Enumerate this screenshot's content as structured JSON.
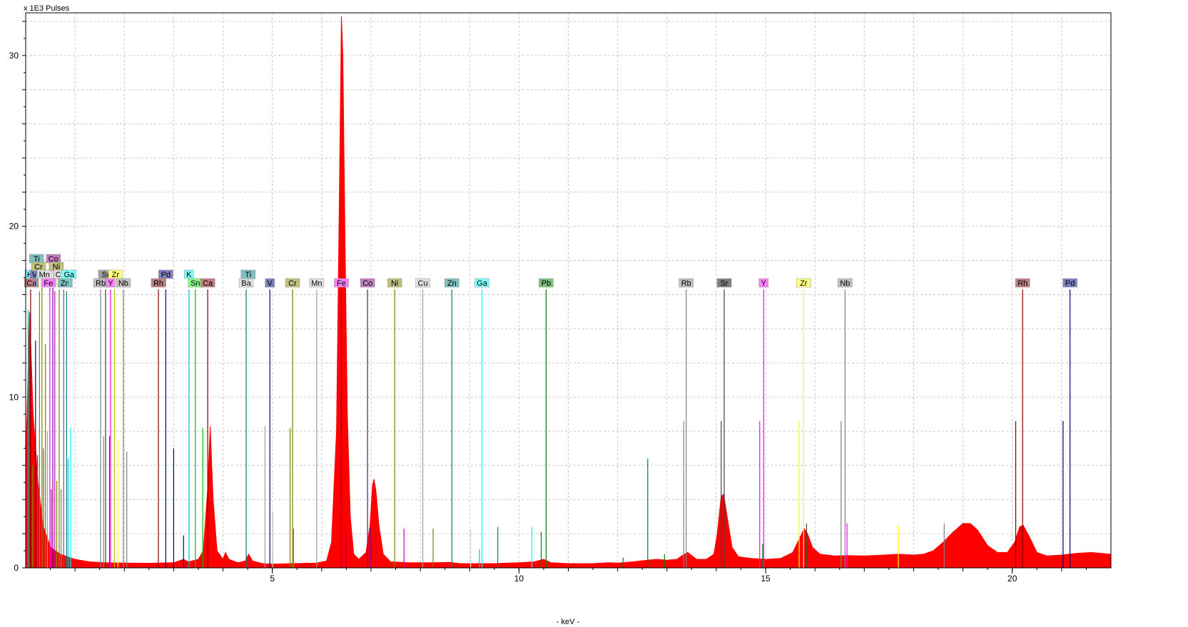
{
  "chart_data": {
    "type": "area",
    "ylabel": "x 1E3 Pulses",
    "xlabel": "- keV -",
    "xlim": [
      0.0,
      22.0
    ],
    "ylim": [
      0,
      32.5
    ],
    "grid": true,
    "x_ticks": [
      5,
      10,
      15,
      20
    ],
    "y_ticks": [
      10,
      20,
      30
    ],
    "spectrum": {
      "color": "#ff0000",
      "points": [
        [
          0.0,
          6.0
        ],
        [
          0.08,
          15.0
        ],
        [
          0.15,
          9.0
        ],
        [
          0.25,
          5.0
        ],
        [
          0.35,
          2.5
        ],
        [
          0.5,
          1.2
        ],
        [
          0.7,
          0.8
        ],
        [
          1.0,
          0.5
        ],
        [
          1.3,
          0.35
        ],
        [
          1.6,
          0.3
        ],
        [
          2.0,
          0.28
        ],
        [
          2.5,
          0.27
        ],
        [
          3.0,
          0.3
        ],
        [
          3.2,
          0.5
        ],
        [
          3.3,
          0.35
        ],
        [
          3.5,
          0.5
        ],
        [
          3.6,
          1.0
        ],
        [
          3.69,
          4.6
        ],
        [
          3.74,
          8.3
        ],
        [
          3.8,
          4.0
        ],
        [
          3.88,
          1.0
        ],
        [
          4.0,
          0.5
        ],
        [
          4.05,
          0.9
        ],
        [
          4.12,
          0.5
        ],
        [
          4.3,
          0.3
        ],
        [
          4.45,
          0.4
        ],
        [
          4.52,
          0.8
        ],
        [
          4.6,
          0.4
        ],
        [
          4.8,
          0.25
        ],
        [
          5.0,
          0.22
        ],
        [
          5.4,
          0.25
        ],
        [
          5.9,
          0.28
        ],
        [
          6.1,
          0.4
        ],
        [
          6.2,
          1.5
        ],
        [
          6.3,
          8.0
        ],
        [
          6.36,
          22.0
        ],
        [
          6.4,
          32.3
        ],
        [
          6.43,
          30.0
        ],
        [
          6.47,
          20.0
        ],
        [
          6.52,
          9.0
        ],
        [
          6.58,
          3.0
        ],
        [
          6.65,
          0.8
        ],
        [
          6.75,
          0.5
        ],
        [
          6.9,
          0.9
        ],
        [
          6.98,
          2.5
        ],
        [
          7.03,
          4.8
        ],
        [
          7.06,
          5.2
        ],
        [
          7.1,
          4.5
        ],
        [
          7.16,
          2.5
        ],
        [
          7.25,
          0.8
        ],
        [
          7.4,
          0.35
        ],
        [
          7.8,
          0.3
        ],
        [
          8.2,
          0.3
        ],
        [
          8.6,
          0.32
        ],
        [
          8.8,
          0.25
        ],
        [
          9.5,
          0.25
        ],
        [
          10.0,
          0.3
        ],
        [
          10.3,
          0.35
        ],
        [
          10.5,
          0.5
        ],
        [
          10.65,
          0.3
        ],
        [
          11.0,
          0.25
        ],
        [
          11.5,
          0.25
        ],
        [
          11.8,
          0.3
        ],
        [
          12.0,
          0.28
        ],
        [
          12.3,
          0.35
        ],
        [
          12.6,
          0.45
        ],
        [
          12.8,
          0.5
        ],
        [
          13.0,
          0.45
        ],
        [
          13.2,
          0.5
        ],
        [
          13.3,
          0.7
        ],
        [
          13.42,
          0.9
        ],
        [
          13.6,
          0.5
        ],
        [
          13.8,
          0.5
        ],
        [
          13.95,
          0.8
        ],
        [
          14.02,
          2.0
        ],
        [
          14.1,
          4.2
        ],
        [
          14.15,
          4.3
        ],
        [
          14.22,
          3.0
        ],
        [
          14.32,
          1.2
        ],
        [
          14.45,
          0.65
        ],
        [
          14.7,
          0.55
        ],
        [
          15.0,
          0.5
        ],
        [
          15.3,
          0.55
        ],
        [
          15.55,
          0.9
        ],
        [
          15.7,
          1.8
        ],
        [
          15.78,
          2.3
        ],
        [
          15.85,
          2.0
        ],
        [
          15.95,
          1.2
        ],
        [
          16.1,
          0.8
        ],
        [
          16.4,
          0.7
        ],
        [
          16.7,
          0.72
        ],
        [
          17.0,
          0.7
        ],
        [
          17.4,
          0.75
        ],
        [
          17.7,
          0.8
        ],
        [
          18.0,
          0.75
        ],
        [
          18.2,
          0.8
        ],
        [
          18.4,
          1.0
        ],
        [
          18.6,
          1.5
        ],
        [
          18.8,
          2.1
        ],
        [
          19.0,
          2.6
        ],
        [
          19.15,
          2.6
        ],
        [
          19.3,
          2.2
        ],
        [
          19.5,
          1.3
        ],
        [
          19.7,
          0.9
        ],
        [
          19.9,
          0.9
        ],
        [
          20.05,
          1.5
        ],
        [
          20.15,
          2.4
        ],
        [
          20.22,
          2.5
        ],
        [
          20.35,
          1.8
        ],
        [
          20.5,
          0.9
        ],
        [
          20.7,
          0.7
        ],
        [
          21.0,
          0.75
        ],
        [
          21.3,
          0.85
        ],
        [
          21.6,
          0.9
        ],
        [
          21.8,
          0.85
        ],
        [
          22.0,
          0.8
        ]
      ]
    },
    "markers": [
      {
        "label": "K",
        "energy": 0.08,
        "row": 2,
        "color": "#80ffff",
        "h": 16.5
      },
      {
        "label": "Ca",
        "energy": 0.12,
        "row": 3,
        "color": "#c08080",
        "h": 16.5
      },
      {
        "label": "V",
        "energy": 0.18,
        "row": 2,
        "color": "#8080c0",
        "h": 16.5
      },
      {
        "label": "Ti",
        "energy": 0.22,
        "row": 0,
        "color": "#80c0c0",
        "h": 16.5
      },
      {
        "label": "Cr",
        "energy": 0.26,
        "row": 1,
        "color": "#c0c080",
        "h": 16.5
      },
      {
        "label": "Mn",
        "energy": 0.38,
        "row": 2,
        "color": "#e0e0e0",
        "h": 16.5
      },
      {
        "label": "Fe",
        "energy": 0.46,
        "row": 3,
        "color": "#ff80ff",
        "h": 16.5
      },
      {
        "label": "Co",
        "energy": 0.56,
        "row": 0,
        "color": "#c080c0",
        "h": 16.5
      },
      {
        "label": "Ni",
        "energy": 0.62,
        "row": 1,
        "color": "#c0c080",
        "h": 16.5
      },
      {
        "label": "C",
        "energy": 0.66,
        "row": 2,
        "color": "#e0e0e0",
        "h": 16.5
      },
      {
        "label": "Zn",
        "energy": 0.8,
        "row": 3,
        "color": "#80c0c0",
        "h": 16.5
      },
      {
        "label": "Ga",
        "energy": 0.88,
        "row": 2,
        "color": "#80ffff",
        "h": 16.5
      },
      {
        "label": "Rb",
        "energy": 1.52,
        "row": 3,
        "color": "#c0c0c0",
        "h": 16.5
      },
      {
        "label": "Sr",
        "energy": 1.62,
        "row": 2,
        "color": "#a0a0a0",
        "h": 16.5
      },
      {
        "label": "Y",
        "energy": 1.72,
        "row": 3,
        "color": "#ff80ff",
        "h": 16.5
      },
      {
        "label": "Zr",
        "energy": 1.82,
        "row": 2,
        "color": "#ffff80",
        "h": 16.5
      },
      {
        "label": "Nb",
        "energy": 1.98,
        "row": 3,
        "color": "#c0c0c0",
        "h": 16.5
      },
      {
        "label": "Rh",
        "energy": 2.69,
        "row": 3,
        "color": "#c08080",
        "h": 16.5
      },
      {
        "label": "Pd",
        "energy": 2.84,
        "row": 2,
        "color": "#8080c0",
        "h": 16.5
      },
      {
        "label": "K",
        "energy": 3.31,
        "row": 2,
        "color": "#80ffff",
        "h": 16.5
      },
      {
        "label": "Sn",
        "energy": 3.44,
        "row": 3,
        "color": "#80ff80",
        "h": 16.5
      },
      {
        "label": "Ca",
        "energy": 3.69,
        "row": 3,
        "color": "#c08080",
        "h": 16.5
      },
      {
        "label": "Ba",
        "energy": 4.47,
        "row": 3,
        "color": "#e0e0e0",
        "h": 16.5
      },
      {
        "label": "Ti",
        "energy": 4.51,
        "row": 2,
        "color": "#80c0c0",
        "h": 16.5
      },
      {
        "label": "V",
        "energy": 4.95,
        "row": 3,
        "color": "#8080c0",
        "h": 16.5
      },
      {
        "label": "Cr",
        "energy": 5.41,
        "row": 3,
        "color": "#c0c080",
        "h": 16.5
      },
      {
        "label": "Mn",
        "energy": 5.9,
        "row": 3,
        "color": "#e0e0e0",
        "h": 16.5
      },
      {
        "label": "Fe",
        "energy": 6.4,
        "row": 3,
        "color": "#ff80ff",
        "h": 16.5
      },
      {
        "label": "Co",
        "energy": 6.93,
        "row": 3,
        "color": "#c080c0",
        "h": 16.5
      },
      {
        "label": "Ni",
        "energy": 7.48,
        "row": 3,
        "color": "#c0c080",
        "h": 16.5
      },
      {
        "label": "Cu",
        "energy": 8.05,
        "row": 3,
        "color": "#e0e0e0",
        "h": 16.5
      },
      {
        "label": "Zn",
        "energy": 8.64,
        "row": 3,
        "color": "#80c0c0",
        "h": 16.5
      },
      {
        "label": "Ga",
        "energy": 9.25,
        "row": 3,
        "color": "#80ffff",
        "h": 16.5
      },
      {
        "label": "Pb",
        "energy": 10.55,
        "row": 3,
        "color": "#80c080",
        "h": 16.5
      },
      {
        "label": "Rb",
        "energy": 13.39,
        "row": 3,
        "color": "#c0c0c0",
        "h": 16.5
      },
      {
        "label": "Sr",
        "energy": 14.16,
        "row": 3,
        "color": "#808080",
        "h": 16.5
      },
      {
        "label": "Y",
        "energy": 14.96,
        "row": 3,
        "color": "#ff80ff",
        "h": 16.5
      },
      {
        "label": "Zr",
        "energy": 15.77,
        "row": 3,
        "color": "#ffff80",
        "h": 16.5
      },
      {
        "label": "Nb",
        "energy": 16.61,
        "row": 3,
        "color": "#c0c0c0",
        "h": 16.5
      },
      {
        "label": "Rh",
        "energy": 20.21,
        "row": 3,
        "color": "#c08080",
        "h": 16.5
      },
      {
        "label": "Pd",
        "energy": 21.17,
        "row": 3,
        "color": "#8080c0",
        "h": 16.5
      }
    ],
    "lines": [
      {
        "energy": 0.05,
        "h": 15.1,
        "color": "#00c0c0"
      },
      {
        "energy": 0.1,
        "h": 16.3,
        "color": "#800000"
      },
      {
        "energy": 0.14,
        "h": 6.0,
        "color": "#808000"
      },
      {
        "energy": 0.2,
        "h": 13.3,
        "color": "#000080"
      },
      {
        "energy": 0.24,
        "h": 6.6,
        "color": "#008080"
      },
      {
        "energy": 0.28,
        "h": 16.2,
        "color": "#808000"
      },
      {
        "energy": 0.33,
        "h": 16.4,
        "color": "#808000"
      },
      {
        "energy": 0.36,
        "h": 7.0,
        "color": "#606060"
      },
      {
        "energy": 0.4,
        "h": 13.1,
        "color": "#808000"
      },
      {
        "energy": 0.44,
        "h": 8.0,
        "color": "#a0a0a0"
      },
      {
        "energy": 0.49,
        "h": 16.4,
        "color": "#ff00ff"
      },
      {
        "energy": 0.52,
        "h": 4.6,
        "color": "#c000c0"
      },
      {
        "energy": 0.55,
        "h": 16.4,
        "color": "#800080"
      },
      {
        "energy": 0.59,
        "h": 16.2,
        "color": "#c000c0"
      },
      {
        "energy": 0.63,
        "h": 5.1,
        "color": "#808000"
      },
      {
        "energy": 0.68,
        "h": 16.3,
        "color": "#808000"
      },
      {
        "energy": 0.72,
        "h": 4.6,
        "color": "#808080"
      },
      {
        "energy": 0.77,
        "h": 16.3,
        "color": "#606060"
      },
      {
        "energy": 0.83,
        "h": 16.2,
        "color": "#008080"
      },
      {
        "energy": 0.86,
        "h": 6.4,
        "color": "#00c0c0"
      },
      {
        "energy": 0.91,
        "h": 8.2,
        "color": "#00ffff"
      },
      {
        "energy": 1.52,
        "h": 16.3,
        "color": "#808080"
      },
      {
        "energy": 1.58,
        "h": 7.7,
        "color": "#808080"
      },
      {
        "energy": 1.62,
        "h": 16.3,
        "color": "#404040"
      },
      {
        "energy": 1.7,
        "h": 7.7,
        "color": "#404040"
      },
      {
        "energy": 1.72,
        "h": 16.3,
        "color": "#ff00ff"
      },
      {
        "energy": 1.8,
        "h": 16.3,
        "color": "#c0c000"
      },
      {
        "energy": 1.87,
        "h": 7.5,
        "color": "#ffff00"
      },
      {
        "energy": 1.98,
        "h": 16.3,
        "color": "#808080"
      },
      {
        "energy": 2.05,
        "h": 6.8,
        "color": "#808080"
      },
      {
        "energy": 2.69,
        "h": 16.3,
        "color": "#800000"
      },
      {
        "energy": 2.84,
        "h": 16.3,
        "color": "#000080"
      },
      {
        "energy": 3.0,
        "h": 7.0,
        "color": "#000080"
      },
      {
        "energy": 3.31,
        "h": 16.3,
        "color": "#00c0c0"
      },
      {
        "energy": 3.44,
        "h": 16.3,
        "color": "#00c000"
      },
      {
        "energy": 3.69,
        "h": 16.3,
        "color": "#800000"
      },
      {
        "energy": 3.59,
        "h": 8.2,
        "color": "#00c000"
      },
      {
        "energy": 4.47,
        "h": 16.3,
        "color": "#008080"
      },
      {
        "energy": 4.85,
        "h": 8.3,
        "color": "#a0a0a0"
      },
      {
        "energy": 4.95,
        "h": 16.3,
        "color": "#000080"
      },
      {
        "energy": 5.41,
        "h": 16.3,
        "color": "#808000"
      },
      {
        "energy": 5.36,
        "h": 8.2,
        "color": "#808000"
      },
      {
        "energy": 5.9,
        "h": 16.3,
        "color": "#a0a0a0"
      },
      {
        "energy": 6.4,
        "h": 16.3,
        "color": "#800080"
      },
      {
        "energy": 6.93,
        "h": 16.3,
        "color": "#800080"
      },
      {
        "energy": 7.48,
        "h": 16.3,
        "color": "#808000"
      },
      {
        "energy": 8.05,
        "h": 16.3,
        "color": "#a0a0a0"
      },
      {
        "energy": 8.64,
        "h": 16.3,
        "color": "#008080"
      },
      {
        "energy": 9.25,
        "h": 16.3,
        "color": "#00ffff"
      },
      {
        "energy": 10.55,
        "h": 16.3,
        "color": "#008000"
      },
      {
        "energy": 12.61,
        "h": 6.4,
        "color": "#008000"
      },
      {
        "energy": 13.34,
        "h": 8.6,
        "color": "#808080"
      },
      {
        "energy": 13.39,
        "h": 16.3,
        "color": "#808080"
      },
      {
        "energy": 14.1,
        "h": 8.6,
        "color": "#404040"
      },
      {
        "energy": 14.16,
        "h": 16.3,
        "color": "#404040"
      },
      {
        "energy": 14.88,
        "h": 8.6,
        "color": "#ff00ff"
      },
      {
        "energy": 14.96,
        "h": 16.3,
        "color": "#ff00ff"
      },
      {
        "energy": 15.68,
        "h": 8.6,
        "color": "#ffff00"
      },
      {
        "energy": 15.77,
        "h": 16.3,
        "color": "#ffff00"
      },
      {
        "energy": 16.53,
        "h": 8.6,
        "color": "#808080"
      },
      {
        "energy": 16.61,
        "h": 16.3,
        "color": "#808080"
      },
      {
        "energy": 17.69,
        "h": 2.5,
        "color": "#ffff00"
      },
      {
        "energy": 18.62,
        "h": 2.6,
        "color": "#808080"
      },
      {
        "energy": 20.07,
        "h": 8.6,
        "color": "#800000"
      },
      {
        "energy": 20.21,
        "h": 16.3,
        "color": "#800000"
      },
      {
        "energy": 21.03,
        "h": 8.6,
        "color": "#000080"
      },
      {
        "energy": 21.17,
        "h": 16.3,
        "color": "#000080"
      },
      {
        "energy": 7.67,
        "h": 2.3,
        "color": "#c000c0"
      },
      {
        "energy": 8.26,
        "h": 2.3,
        "color": "#808000"
      },
      {
        "energy": 9.2,
        "h": 1.1,
        "color": "#00c0c0"
      },
      {
        "energy": 9.57,
        "h": 2.4,
        "color": "#008080"
      },
      {
        "energy": 10.26,
        "h": 2.4,
        "color": "#00ffff"
      },
      {
        "energy": 10.45,
        "h": 2.1,
        "color": "#008000"
      },
      {
        "energy": 12.11,
        "h": 0.6,
        "color": "#008000"
      },
      {
        "energy": 12.95,
        "h": 0.8,
        "color": "#008000"
      },
      {
        "energy": 3.2,
        "h": 1.9,
        "color": "#000080"
      },
      {
        "energy": 5.01,
        "h": 3.3,
        "color": "#c0c0c0"
      },
      {
        "energy": 5.43,
        "h": 2.3,
        "color": "#808000"
      },
      {
        "energy": 6.49,
        "h": 2.2,
        "color": "#800080"
      },
      {
        "energy": 6.99,
        "h": 2.3,
        "color": "#800080"
      },
      {
        "energy": 9.02,
        "h": 2.3,
        "color": "#e0e0e0"
      },
      {
        "energy": 16.65,
        "h": 2.6,
        "color": "#ff00ff"
      },
      {
        "energy": 15.83,
        "h": 2.6,
        "color": "#404040"
      },
      {
        "energy": 14.94,
        "h": 1.4,
        "color": "#008000"
      }
    ]
  }
}
